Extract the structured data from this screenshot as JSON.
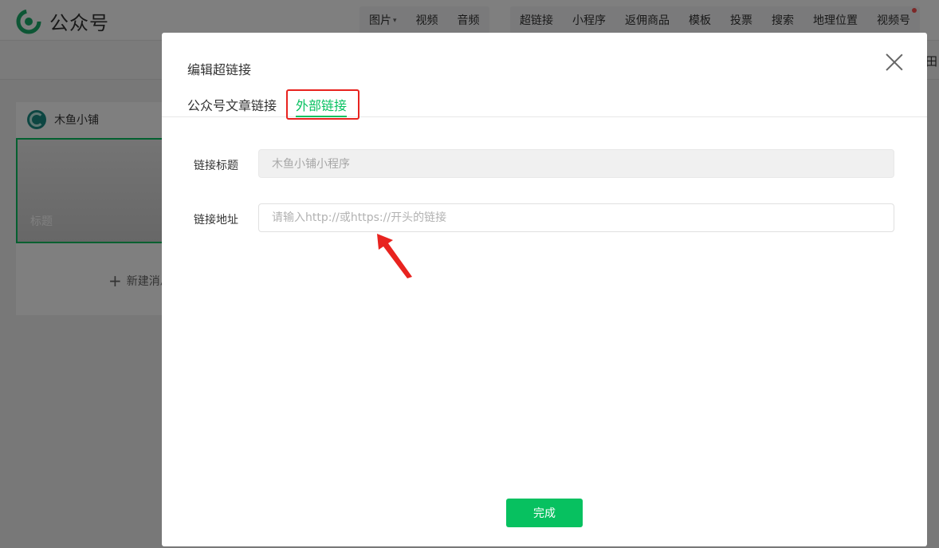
{
  "app": {
    "title": "公众号"
  },
  "toolbar": {
    "media_items": [
      "图片",
      "视频",
      "音频"
    ],
    "insert_items": [
      "超链接",
      "小程序",
      "返佣商品",
      "模板",
      "投票",
      "搜索",
      "地理位置",
      "视频号"
    ]
  },
  "sidebar_glyph": "田",
  "account": {
    "name": "木鱼小铺"
  },
  "article_card": {
    "cover_title": "标题",
    "new_message_label": "新建消息"
  },
  "dialog": {
    "title": "编辑超链接",
    "tabs": [
      {
        "label": "公众号文章链接",
        "active": false
      },
      {
        "label": "外部链接",
        "active": true
      }
    ],
    "form": {
      "title_label": "链接标题",
      "title_value": "木鱼小铺小程序",
      "url_label": "链接地址",
      "url_placeholder": "请输入http://或https://开头的链接",
      "url_value": ""
    },
    "done_label": "完成"
  },
  "colors": {
    "accent": "#07c160",
    "highlight": "#e8231f",
    "mask": "rgba(0,0,0,0.5)"
  }
}
